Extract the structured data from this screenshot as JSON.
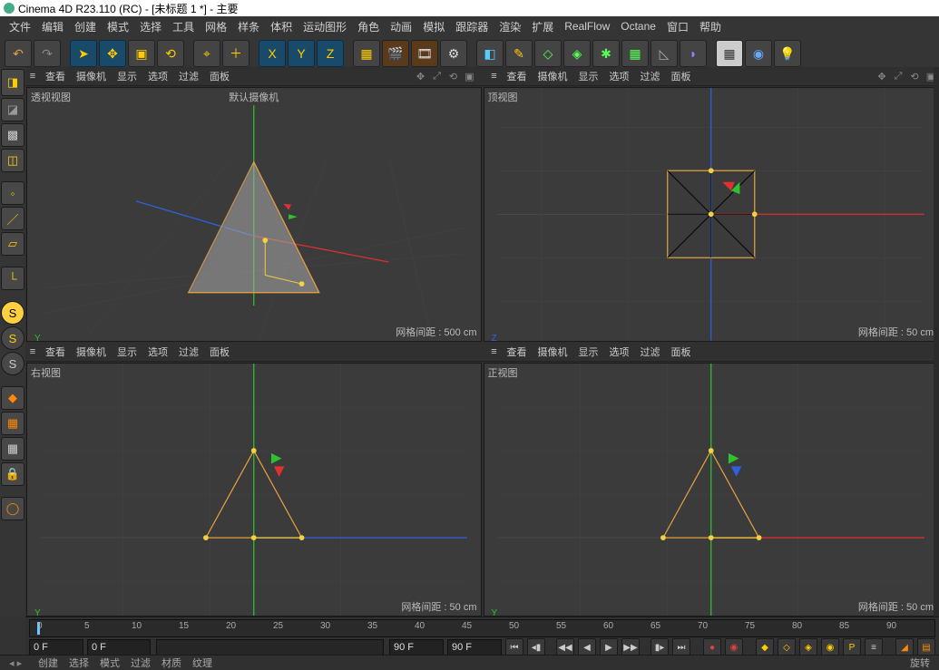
{
  "app": {
    "title": "Cinema 4D R23.110 (RC) - [未标题 1 *] - 主要"
  },
  "menu": [
    "文件",
    "编辑",
    "创建",
    "模式",
    "选择",
    "工具",
    "网格",
    "样条",
    "体积",
    "运动图形",
    "角色",
    "动画",
    "模拟",
    "跟踪器",
    "渲染",
    "扩展",
    "RealFlow",
    "Octane",
    "窗口",
    "帮助"
  ],
  "view_tab": {
    "lbl1": "查看",
    "lbl2": "摄像机",
    "lbl3": "显示",
    "lbl4": "选项",
    "lbl5": "过滤",
    "lbl6": "面板"
  },
  "view_tab_b": {
    "lbl1": "查看",
    "lbl2": "摄像机",
    "lbl3": "显示",
    "lbl4": "选项",
    "lbl5": "过滤",
    "lbl6": "面板"
  },
  "viewport": {
    "persp": {
      "label": "透视视图",
      "cam": "默认摄像机 ",
      "grid": "网格间距 : 500 cm"
    },
    "top": {
      "label": "顶视图",
      "grid": "网格间距 : 50 cm"
    },
    "right": {
      "label": "右视图",
      "grid": "网格间距 : 50 cm"
    },
    "front": {
      "label": "正视图",
      "grid": "网格间距 : 50 cm"
    }
  },
  "timeline": {
    "start": "0 F",
    "end": "90 F",
    "cur": "0 F",
    "lim": "90 F",
    "ticks": [
      "0",
      "5",
      "10",
      "15",
      "20",
      "25",
      "30",
      "35",
      "40",
      "45",
      "50",
      "55",
      "60",
      "65",
      "70",
      "75",
      "80",
      "85",
      "90"
    ]
  },
  "status": [
    "创建",
    "选择",
    "模式",
    "过滤",
    "材质",
    "纹理",
    "...",
    "...",
    "旋转"
  ]
}
